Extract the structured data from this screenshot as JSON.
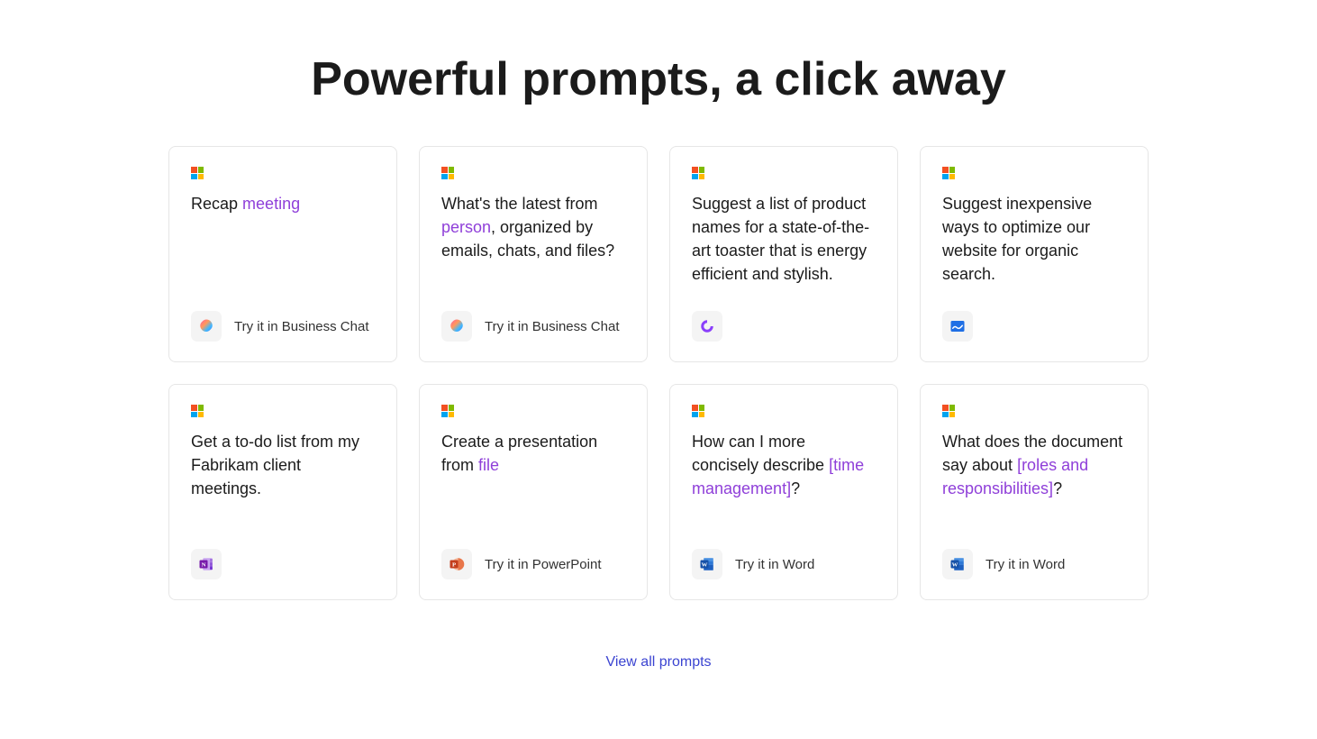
{
  "heading": "Powerful prompts, a click away",
  "view_all": "View all prompts",
  "cards": [
    {
      "text": [
        {
          "t": "Recap ",
          "ph": false
        },
        {
          "t": "meeting",
          "ph": true
        }
      ],
      "app": "copilot",
      "try_label": "Try it in Business Chat"
    },
    {
      "text": [
        {
          "t": "What's the latest from ",
          "ph": false
        },
        {
          "t": "person",
          "ph": true
        },
        {
          "t": ", organized by emails, chats, and files?",
          "ph": false
        }
      ],
      "app": "copilot",
      "try_label": "Try it in Business Chat"
    },
    {
      "text": [
        {
          "t": "Suggest a list of product names for a state-of-the-art toaster that is energy efficient and stylish.",
          "ph": false
        }
      ],
      "app": "loop",
      "try_label": ""
    },
    {
      "text": [
        {
          "t": "Suggest inexpensive ways to optimize our website for organic search.",
          "ph": false
        }
      ],
      "app": "whiteboard",
      "try_label": ""
    },
    {
      "text": [
        {
          "t": "Get a to-do list from my Fabrikam client meetings.",
          "ph": false
        }
      ],
      "app": "onenote",
      "try_label": ""
    },
    {
      "text": [
        {
          "t": "Create a presentation from ",
          "ph": false
        },
        {
          "t": "file",
          "ph": true
        }
      ],
      "app": "powerpoint",
      "try_label": "Try it in PowerPoint"
    },
    {
      "text": [
        {
          "t": "How can I more concisely describe ",
          "ph": false
        },
        {
          "t": "[time management]",
          "ph": true
        },
        {
          "t": "?",
          "ph": false
        }
      ],
      "app": "word",
      "try_label": "Try it in Word"
    },
    {
      "text": [
        {
          "t": "What does the document say about ",
          "ph": false
        },
        {
          "t": "[roles and responsibilities]",
          "ph": true
        },
        {
          "t": "?",
          "ph": false
        }
      ],
      "app": "word",
      "try_label": "Try it in Word"
    }
  ]
}
